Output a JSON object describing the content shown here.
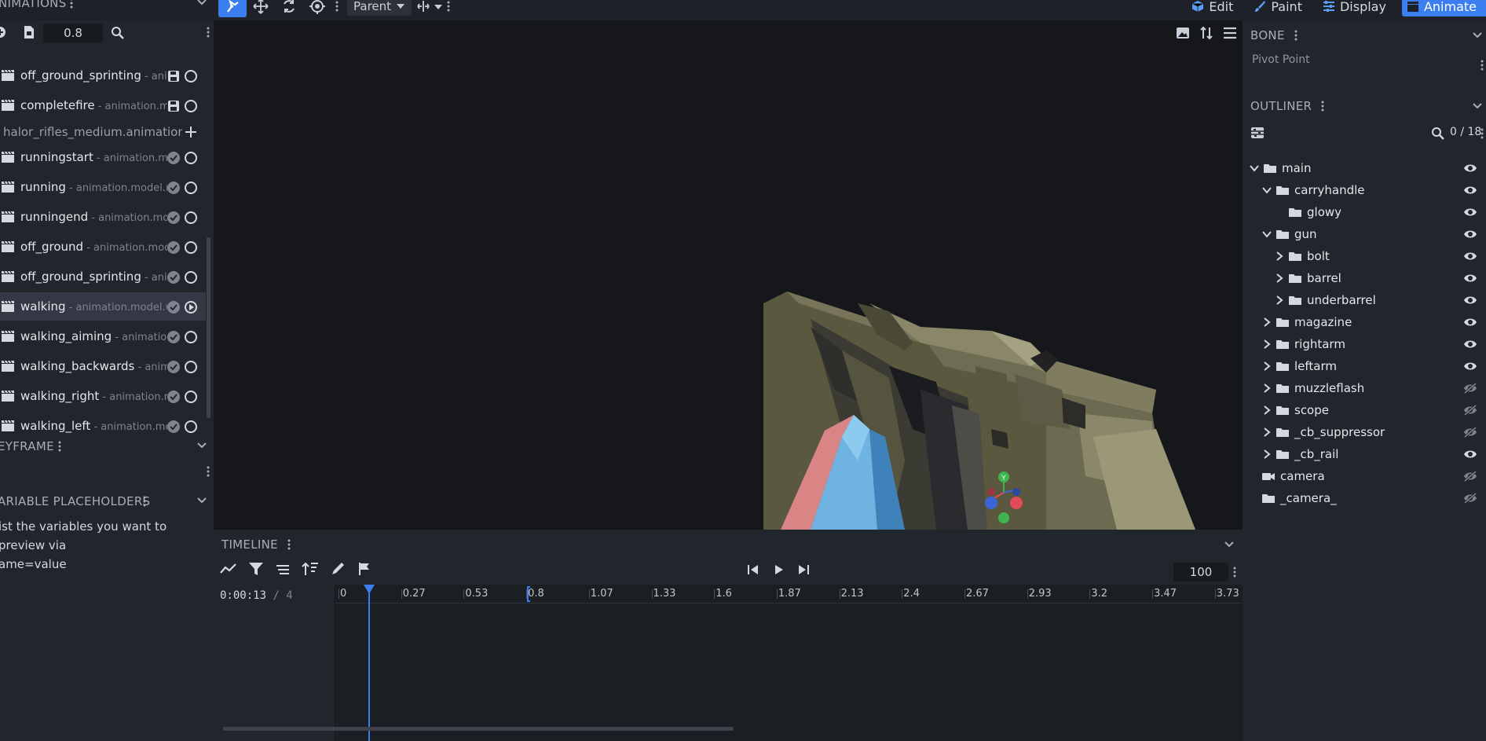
{
  "topbar": {
    "animations_title": "NIMATIONS",
    "parent_label": "Parent",
    "modes": [
      {
        "label": "Edit",
        "icon": "cube-icon",
        "active": false
      },
      {
        "label": "Paint",
        "icon": "brush-icon",
        "active": false
      },
      {
        "label": "Display",
        "icon": "sliders-icon",
        "active": false
      },
      {
        "label": "Animate",
        "icon": "clapper-icon",
        "active": true
      }
    ]
  },
  "animations": {
    "speed_value": "0.8",
    "rows": [
      {
        "name": "off_ground_sprinting",
        "file": " - animation.model.off_ground_sprinting",
        "status": "save-icon"
      },
      {
        "name": "completefire",
        "file": " - animation.model.completefire",
        "status": "save-icon"
      },
      {
        "name": "runningstart",
        "file": " - animation.model.runningstart",
        "status": "check-icon"
      },
      {
        "name": "running",
        "file": " - animation.model.running",
        "status": "check-icon"
      },
      {
        "name": "runningend",
        "file": " - animation.model.runningend",
        "status": "check-icon"
      },
      {
        "name": "off_ground",
        "file": " - animation.model.off_ground",
        "status": "check-icon"
      },
      {
        "name": "off_ground_sprinting",
        "file": " - animation.model.off_ground_sprinting",
        "status": "check-icon"
      },
      {
        "name": "walking",
        "file": " - animation.model.walking",
        "status": "check-icon",
        "selected": true
      },
      {
        "name": "walking_aiming",
        "file": " - animation.model.walking_aiming",
        "status": "check-icon"
      },
      {
        "name": "walking_backwards",
        "file": " - animation.model.walking_backwards",
        "status": "check-icon"
      },
      {
        "name": "walking_right",
        "file": " - animation.model.walking_right",
        "status": "check-icon"
      },
      {
        "name": "walking_left",
        "file": " - animation.model.walking_left",
        "status": "check-icon"
      }
    ],
    "file_group": "halor_rifles_medium.animation.json"
  },
  "keyframe": {
    "title": "EYFRAME"
  },
  "variables": {
    "title": "ARIABLE PLACEHOLDERS",
    "line1": "ist the variables you want to preview via",
    "line2": "ame=value"
  },
  "timeline": {
    "title": "TIMELINE",
    "current_time": "0:00:13",
    "total": " / 4",
    "frame_count": "100",
    "ticks": [
      "0",
      "0.27",
      "0.53",
      "0.8",
      "1.07",
      "1.33",
      "1.6",
      "1.87",
      "2.13",
      "2.4",
      "2.67",
      "2.93",
      "3.2",
      "3.47",
      "3.73"
    ]
  },
  "bone": {
    "title": "BONE",
    "pivot_label": "Pivot Point"
  },
  "outliner": {
    "title": "OUTLINER",
    "count": "0 / 18",
    "tree": [
      {
        "name": "main",
        "depth": 0,
        "arrow": "down",
        "type": "folder",
        "visible": true
      },
      {
        "name": "carryhandle",
        "depth": 1,
        "arrow": "down",
        "type": "folder",
        "visible": true
      },
      {
        "name": "glowy",
        "depth": 2,
        "arrow": "none",
        "type": "folder",
        "visible": true
      },
      {
        "name": "gun",
        "depth": 1,
        "arrow": "down",
        "type": "folder",
        "visible": true
      },
      {
        "name": "bolt",
        "depth": 2,
        "arrow": "right",
        "type": "folder",
        "visible": true
      },
      {
        "name": "barrel",
        "depth": 2,
        "arrow": "right",
        "type": "folder",
        "visible": true
      },
      {
        "name": "underbarrel",
        "depth": 2,
        "arrow": "right",
        "type": "folder",
        "visible": true
      },
      {
        "name": "magazine",
        "depth": 1,
        "arrow": "right",
        "type": "folder",
        "visible": true
      },
      {
        "name": "rightarm",
        "depth": 1,
        "arrow": "right",
        "type": "folder",
        "visible": true
      },
      {
        "name": "leftarm",
        "depth": 1,
        "arrow": "right",
        "type": "folder",
        "visible": true
      },
      {
        "name": "muzzleflash",
        "depth": 1,
        "arrow": "right",
        "type": "folder",
        "visible": false
      },
      {
        "name": "scope",
        "depth": 1,
        "arrow": "right",
        "type": "folder",
        "visible": false
      },
      {
        "name": "_cb_suppressor",
        "depth": 1,
        "arrow": "right",
        "type": "folder",
        "visible": false
      },
      {
        "name": "_cb_rail",
        "depth": 1,
        "arrow": "right",
        "type": "folder",
        "visible": true
      },
      {
        "name": "camera",
        "depth": 0,
        "arrow": "none",
        "type": "camera",
        "visible": false
      },
      {
        "name": "_camera_",
        "depth": 0,
        "arrow": "none",
        "type": "folder",
        "visible": false
      }
    ]
  },
  "gizmo": {
    "y": "Y",
    "x": "X",
    "z": "Z"
  },
  "colors": {
    "accent": "#3a7ef0",
    "panel": "#21252c",
    "viewport": "#15171b"
  }
}
